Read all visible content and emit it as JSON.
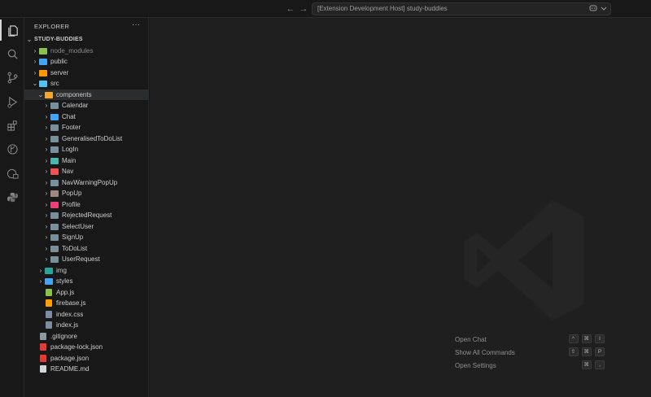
{
  "titlebar": {
    "back_glyph": "←",
    "forward_glyph": "→",
    "command_center_text": "[Extension Development Host] study-buddies"
  },
  "sidebar": {
    "title": "EXPLORER",
    "more": "···",
    "root": "STUDY-BUDDIES",
    "tree": [
      {
        "label": "node_modules",
        "depth": 1,
        "kind": "folder",
        "chev": "›",
        "color": "#8bc34a",
        "dim": true
      },
      {
        "label": "public",
        "depth": 1,
        "kind": "folder",
        "chev": "›",
        "color": "#42a5f5"
      },
      {
        "label": "server",
        "depth": 1,
        "kind": "folder",
        "chev": "›",
        "color": "#ff9800"
      },
      {
        "label": "src",
        "depth": 1,
        "kind": "folder",
        "chev": "⌄",
        "color": "#4fc3f7",
        "open": true
      },
      {
        "label": "components",
        "depth": 2,
        "kind": "folder",
        "chev": "⌄",
        "color": "#f9a825",
        "selected": true
      },
      {
        "label": "Calendar",
        "depth": 3,
        "kind": "folder",
        "chev": "›",
        "color": "#78909c"
      },
      {
        "label": "Chat",
        "depth": 3,
        "kind": "folder",
        "chev": "›",
        "color": "#42a5f5"
      },
      {
        "label": "Footer",
        "depth": 3,
        "kind": "folder",
        "chev": "›",
        "color": "#78909c"
      },
      {
        "label": "GeneralisedToDoList",
        "depth": 3,
        "kind": "folder",
        "chev": "›",
        "color": "#78909c"
      },
      {
        "label": "LogIn",
        "depth": 3,
        "kind": "folder",
        "chev": "›",
        "color": "#78909c"
      },
      {
        "label": "Main",
        "depth": 3,
        "kind": "folder",
        "chev": "›",
        "color": "#4db6ac"
      },
      {
        "label": "Nav",
        "depth": 3,
        "kind": "folder",
        "chev": "›",
        "color": "#ef5350"
      },
      {
        "label": "NavWarningPopUp",
        "depth": 3,
        "kind": "folder",
        "chev": "›",
        "color": "#78909c"
      },
      {
        "label": "PopUp",
        "depth": 3,
        "kind": "folder",
        "chev": "›",
        "color": "#a1887f"
      },
      {
        "label": "Profile",
        "depth": 3,
        "kind": "folder",
        "chev": "›",
        "color": "#ec407a"
      },
      {
        "label": "RejectedRequest",
        "depth": 3,
        "kind": "folder",
        "chev": "›",
        "color": "#78909c"
      },
      {
        "label": "SelectUser",
        "depth": 3,
        "kind": "folder",
        "chev": "›",
        "color": "#78909c"
      },
      {
        "label": "SignUp",
        "depth": 3,
        "kind": "folder",
        "chev": "›",
        "color": "#78909c"
      },
      {
        "label": "ToDoList",
        "depth": 3,
        "kind": "folder",
        "chev": "›",
        "color": "#78909c"
      },
      {
        "label": "UserRequest",
        "depth": 3,
        "kind": "folder",
        "chev": "›",
        "color": "#78909c"
      },
      {
        "label": "img",
        "depth": 2,
        "kind": "folder",
        "chev": "›",
        "color": "#26a69a"
      },
      {
        "label": "styles",
        "depth": 2,
        "kind": "folder",
        "chev": "›",
        "color": "#42a5f5"
      },
      {
        "label": "App.js",
        "depth": 2,
        "kind": "file",
        "color": "#8bc34a"
      },
      {
        "label": "firebase.js",
        "depth": 2,
        "kind": "file",
        "color": "#ffa000"
      },
      {
        "label": "index.css",
        "depth": 2,
        "kind": "file",
        "color": "#7e8ca3"
      },
      {
        "label": "index.js",
        "depth": 2,
        "kind": "file",
        "color": "#7e8ca3"
      },
      {
        "label": ".gitignore",
        "depth": 1,
        "kind": "file",
        "color": "#8a9aa0"
      },
      {
        "label": "package-lock.json",
        "depth": 1,
        "kind": "file",
        "color": "#e53935"
      },
      {
        "label": "package.json",
        "depth": 1,
        "kind": "file",
        "color": "#e53935"
      },
      {
        "label": "README.md",
        "depth": 1,
        "kind": "file",
        "color": "#cfd8dc"
      }
    ]
  },
  "editor": {
    "hints": [
      {
        "label": "Open Chat",
        "keys": [
          "^",
          "⌘",
          "I"
        ]
      },
      {
        "label": "Show All Commands",
        "keys": [
          "⇧",
          "⌘",
          "P"
        ]
      },
      {
        "label": "Open Settings",
        "keys": [
          "⌘",
          ","
        ]
      }
    ]
  }
}
